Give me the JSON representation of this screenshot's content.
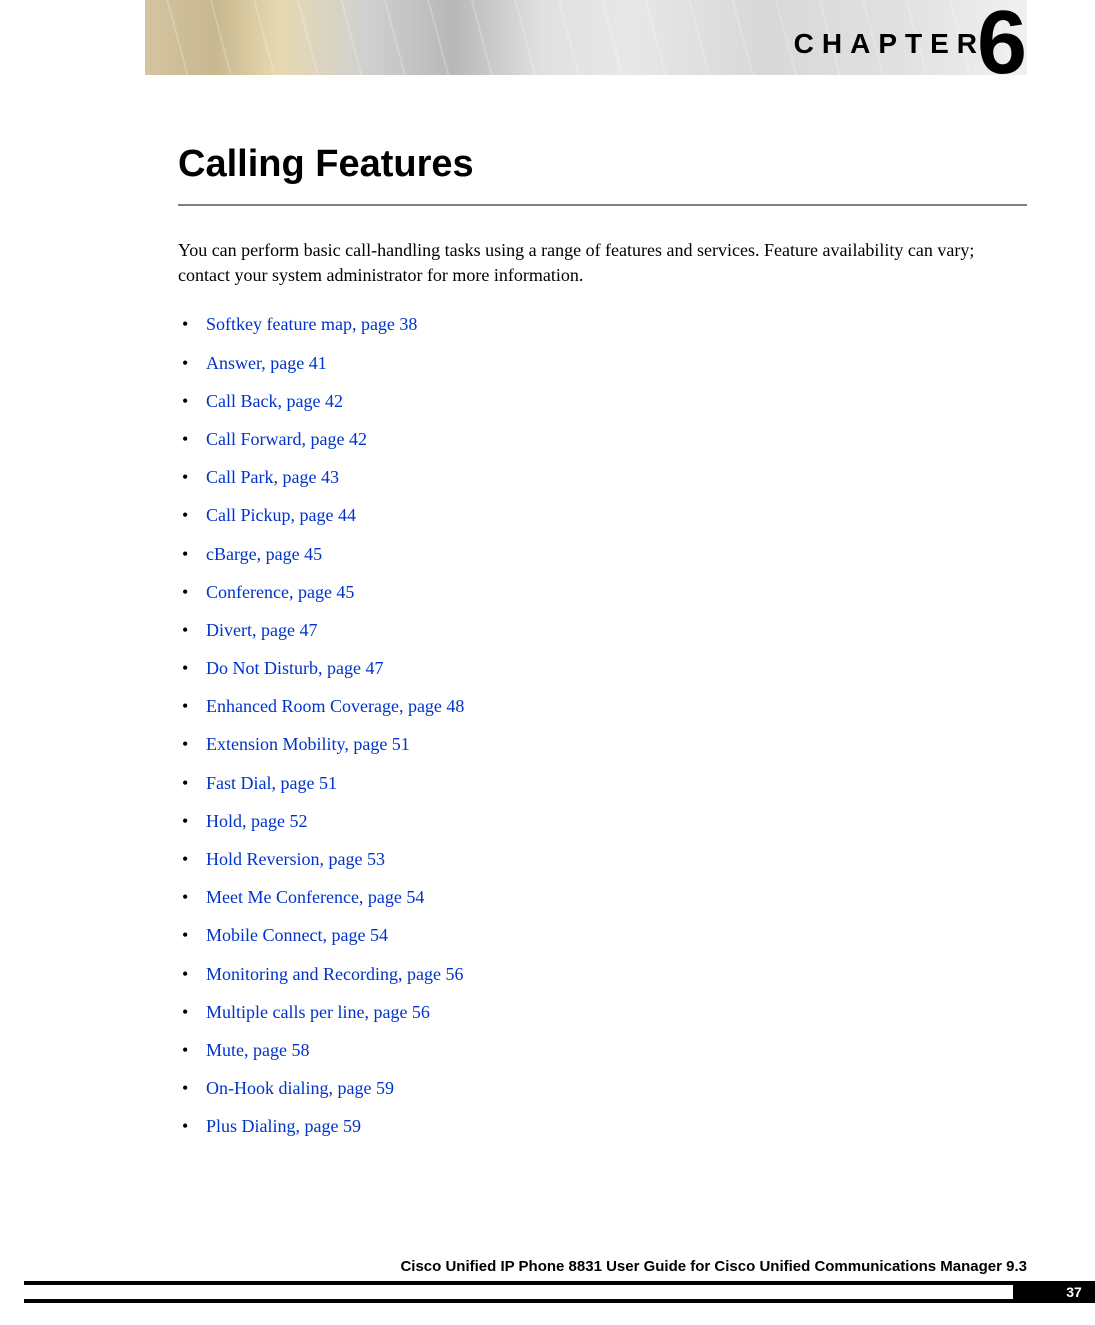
{
  "chapter": {
    "label": "CHAPTER",
    "number": "6"
  },
  "title": "Calling Features",
  "intro": "You can perform basic call-handling tasks using a range of features and services. Feature availability can vary; contact your system administrator for more information.",
  "toc_items": [
    "Softkey feature map,  page  38",
    "Answer,  page  41",
    "Call Back,  page  42",
    "Call Forward,  page  42",
    "Call Park,  page  43",
    "Call Pickup,  page  44",
    "cBarge,  page  45",
    "Conference,  page  45",
    "Divert,  page  47",
    "Do Not Disturb,  page  47",
    "Enhanced Room Coverage,  page  48",
    "Extension Mobility,  page  51",
    "Fast Dial,  page  51",
    "Hold,  page  52",
    "Hold Reversion,  page  53",
    "Meet Me Conference,  page  54",
    "Mobile Connect,  page  54",
    "Monitoring and Recording,  page  56",
    "Multiple calls per line,  page  56",
    "Mute,  page  58",
    "On-Hook dialing,  page  59",
    "Plus Dialing,  page  59"
  ],
  "footer": {
    "title": "Cisco Unified IP Phone 8831 User Guide for Cisco Unified Communications Manager 9.3",
    "page": "37"
  }
}
